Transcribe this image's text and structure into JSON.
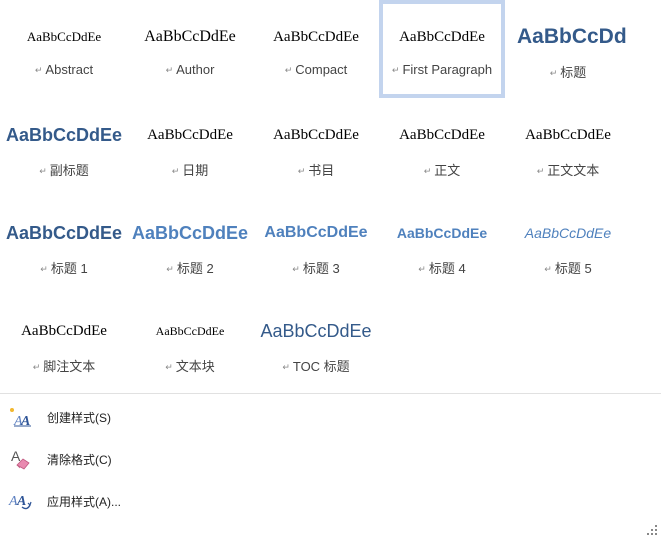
{
  "styles": [
    {
      "preview": "AaBbCcDdEe",
      "label": "Abstract",
      "variant": "s-serif-sm"
    },
    {
      "preview": "AaBbCcDdEe",
      "label": "Author",
      "variant": "s-serif"
    },
    {
      "preview": "AaBbCcDdEe",
      "label": "Compact",
      "variant": "s-serif-md"
    },
    {
      "preview": "AaBbCcDdEe",
      "label": "First Paragraph",
      "variant": "s-serif-md",
      "selected": true
    },
    {
      "preview": "AaBbCcDd",
      "label": "标题",
      "variant": "s-title"
    },
    {
      "preview": "AaBbCcDdEe",
      "label": "副标题",
      "variant": "s-subtitle"
    },
    {
      "preview": "AaBbCcDdEe",
      "label": "日期",
      "variant": "s-serif-md"
    },
    {
      "preview": "AaBbCcDdEe",
      "label": "书目",
      "variant": "s-serif-md"
    },
    {
      "preview": "AaBbCcDdEe",
      "label": "正文",
      "variant": "s-serif-md"
    },
    {
      "preview": "AaBbCcDdEe",
      "label": "正文文本",
      "variant": "s-serif-md"
    },
    {
      "preview": "AaBbCcDdEe",
      "label": "标题 1",
      "variant": "s-h1"
    },
    {
      "preview": "AaBbCcDdEe",
      "label": "标题 2",
      "variant": "s-h2"
    },
    {
      "preview": "AaBbCcDdEe",
      "label": "标题 3",
      "variant": "s-h3"
    },
    {
      "preview": "AaBbCcDdEe",
      "label": "标题 4",
      "variant": "s-h4"
    },
    {
      "preview": "AaBbCcDdEe",
      "label": "标题 5",
      "variant": "s-h5"
    },
    {
      "preview": "AaBbCcDdEe",
      "label": "脚注文本",
      "variant": "s-foot"
    },
    {
      "preview": "AaBbCcDdEe",
      "label": "文本块",
      "variant": "s-block"
    },
    {
      "preview": "AaBbCcDdEe",
      "label": "TOC 标题",
      "variant": "s-toc"
    }
  ],
  "paragraph_mark": "↵",
  "commands": {
    "create": {
      "label": "创建样式(S)",
      "icon": "create-style-icon"
    },
    "clear": {
      "label": "清除格式(C)",
      "icon": "eraser-icon"
    },
    "apply": {
      "label": "应用样式(A)...",
      "icon": "apply-styles-icon"
    }
  },
  "colors": {
    "selected_border": "#c3d4ee",
    "heading_dark": "#345a8a",
    "heading_light": "#4f81bd"
  }
}
